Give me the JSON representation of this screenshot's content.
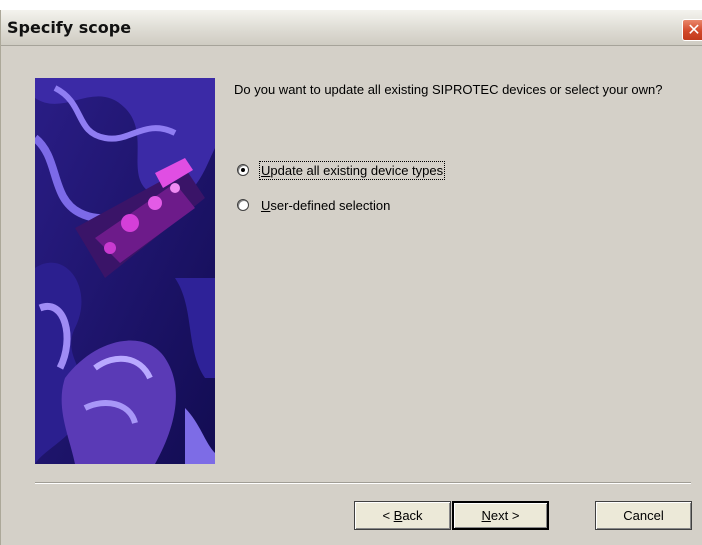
{
  "window": {
    "title": "Specify scope",
    "close_glyph": "✕"
  },
  "main": {
    "question": "Do you want to update all existing SIPROTEC devices or select your own?",
    "options": [
      {
        "mnemonic": "U",
        "rest": "pdate all existing device types",
        "checked": true
      },
      {
        "mnemonic": "U",
        "rest": "ser-defined selection",
        "checked": false
      }
    ]
  },
  "buttons": {
    "back": {
      "prefix": "< ",
      "mnemonic": "B",
      "rest": "ack"
    },
    "next": {
      "mnemonic": "N",
      "rest": "ext >"
    },
    "cancel": "Cancel"
  }
}
